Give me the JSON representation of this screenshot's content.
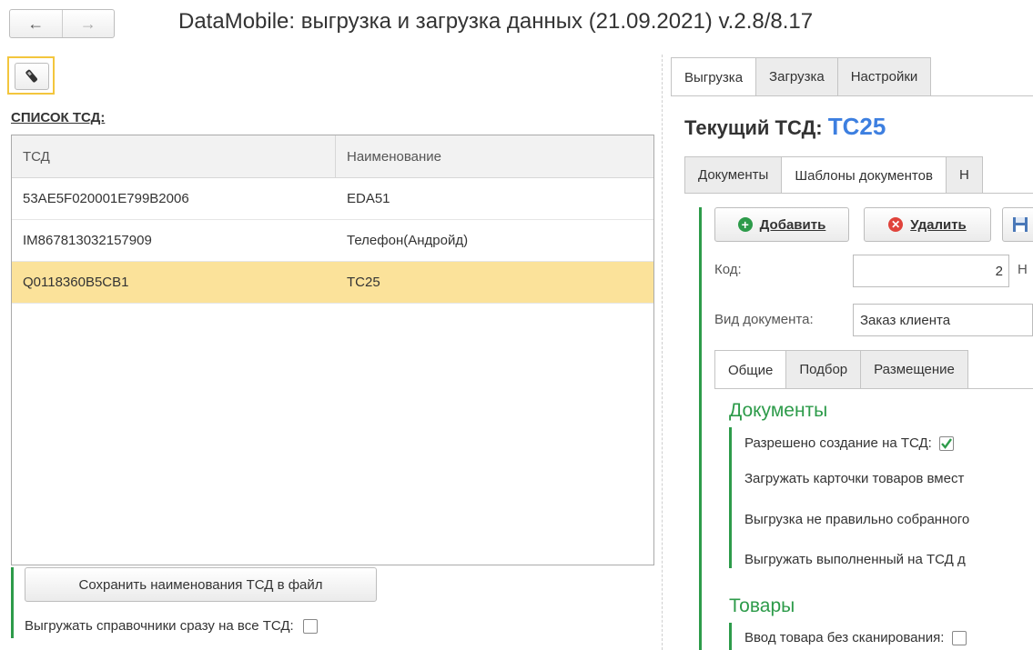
{
  "window": {
    "title": "DataMobile: выгрузка и загрузка данных  (21.09.2021) v.2.8/8.17",
    "nav_back": "←",
    "nav_forward": "→"
  },
  "left": {
    "list_label": "СПИСОК ТСД:",
    "columns": [
      "ТСД",
      "Наименование"
    ],
    "rows": [
      {
        "tsd": "53AE5F020001E799B2006",
        "name": "EDA51"
      },
      {
        "tsd": "IM867813032157909",
        "name": "Телефон(Андройд)"
      },
      {
        "tsd": "Q0118360B5CB1",
        "name": "TC25"
      }
    ],
    "selected_row": 2,
    "save_button": "Сохранить наименования ТСД в файл",
    "upload_all_label": "Выгружать справочники сразу на все ТСД:",
    "upload_all_checked": false
  },
  "right": {
    "tabs": [
      "Выгрузка",
      "Загрузка",
      "Настройки"
    ],
    "active_tab": "Выгрузка",
    "current_label": "Текущий ТСД:",
    "current_value": "TC25",
    "subtabs": [
      "Документы",
      "Шаблоны документов",
      "Н"
    ],
    "active_subtab": "Шаблоны документов",
    "add_button": "Добавить",
    "delete_button": "Удалить",
    "code_label": "Код:",
    "code_value": "2",
    "code_side_label": "Н",
    "doctype_label": "Вид документа:",
    "doctype_value": "Заказ клиента",
    "inner_tabs": [
      "Общие",
      "Подбор",
      "Размещение"
    ],
    "active_inner_tab": "Общие",
    "docs_section": "Документы",
    "allow_create_label": "Разрешено создание на ТСД:",
    "allow_create_checked": true,
    "load_cards_label": "Загружать карточки товаров вмест",
    "upload_wrong_label": "Выгрузка не правильно собранного",
    "upload_done_label": "Выгружать выполненный на ТСД д",
    "goods_section": "Товары",
    "manual_input_label": "Ввод товара без сканирования:",
    "manual_input_checked": false
  },
  "colors": {
    "selected_row": "#fbe29a",
    "accent_green": "#2d9b4a",
    "current_value_blue": "#3d7fe0",
    "device_highlight": "#f3c63d"
  }
}
